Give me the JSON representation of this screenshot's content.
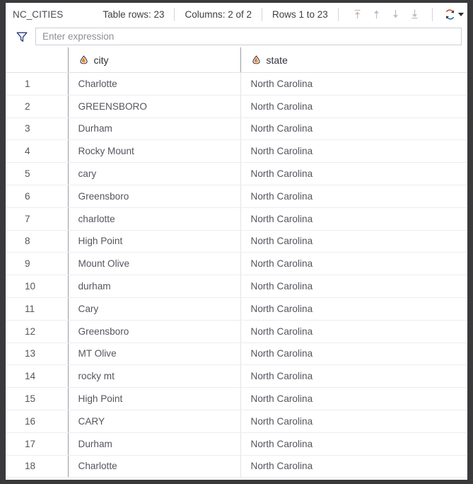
{
  "toolbar": {
    "table_name": "NC_CITIES",
    "table_rows": "Table rows: 23",
    "columns": "Columns: 2 of 2",
    "rows_range": "Rows 1 to 23",
    "nav": [
      {
        "name": "first-page-button",
        "icon": "arrow-up-to-line-icon"
      },
      {
        "name": "previous-page-button",
        "icon": "arrow-up-icon"
      },
      {
        "name": "next-page-button",
        "icon": "arrow-down-icon"
      },
      {
        "name": "last-page-button",
        "icon": "arrow-down-to-line-icon"
      }
    ],
    "refresh_icon": "refresh-icon",
    "refresh_caret": "chevron-down-icon"
  },
  "filter": {
    "funnel_icon": "filter-funnel-icon",
    "expression_value": "",
    "expression_placeholder": "Enter expression"
  },
  "table": {
    "row_number_header": "",
    "columns": [
      {
        "label": "city",
        "type_icon": "string-type-icon"
      },
      {
        "label": "state",
        "type_icon": "string-type-icon"
      }
    ],
    "rows": [
      {
        "n": "1",
        "city": "Charlotte",
        "state": "North Carolina"
      },
      {
        "n": "2",
        "city": "GREENSBORO",
        "state": "North Carolina"
      },
      {
        "n": "3",
        "city": "Durham",
        "state": "North Carolina"
      },
      {
        "n": "4",
        "city": "Rocky Mount",
        "state": "North Carolina"
      },
      {
        "n": "5",
        "city": "cary",
        "state": "North Carolina"
      },
      {
        "n": "6",
        "city": "Greensboro",
        "state": "North Carolina"
      },
      {
        "n": "7",
        "city": "charlotte",
        "state": "North Carolina"
      },
      {
        "n": "8",
        "city": "High Point",
        "state": "North Carolina"
      },
      {
        "n": "9",
        "city": "Mount Olive",
        "state": "North Carolina"
      },
      {
        "n": "10",
        "city": "durham",
        "state": "North Carolina"
      },
      {
        "n": "11",
        "city": "Cary",
        "state": "North Carolina"
      },
      {
        "n": "12",
        "city": "Greensboro",
        "state": "North Carolina"
      },
      {
        "n": "13",
        "city": "MT Olive",
        "state": "North Carolina"
      },
      {
        "n": "14",
        "city": "rocky mt",
        "state": "North Carolina"
      },
      {
        "n": "15",
        "city": "High Point",
        "state": "North Carolina"
      },
      {
        "n": "16",
        "city": "CARY",
        "state": "North Carolina"
      },
      {
        "n": "17",
        "city": "Durham",
        "state": "North Carolina"
      },
      {
        "n": "18",
        "city": "Charlotte",
        "state": "North Carolina"
      }
    ]
  },
  "colors": {
    "frame": "#3a3a3c",
    "panel": "#ffffff",
    "text": "#3e3e42",
    "muted_text": "#8e8e98",
    "grid_line": "#ededf1",
    "divider": "#9a9aa6",
    "funnel_stroke": "#2b3a7a",
    "nav_arrow": "#b9b9c2",
    "nav_arrow_first": "#c9b3b3",
    "refresh_accent": "#2b2b33"
  }
}
